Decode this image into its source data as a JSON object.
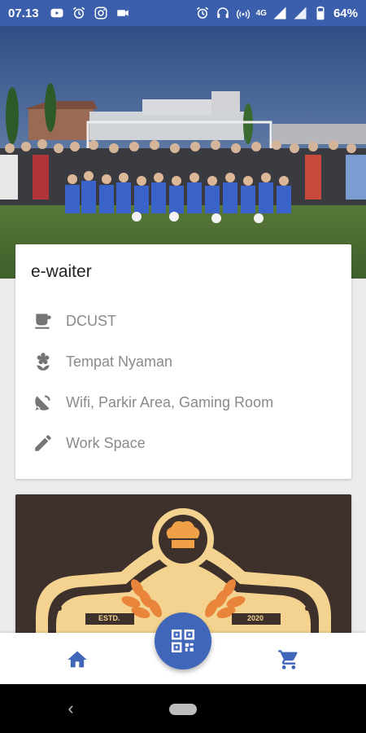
{
  "status_bar": {
    "time": "07.13",
    "left_icons": [
      "youtube-icon",
      "alarm-icon",
      "instagram-icon",
      "video-icon"
    ],
    "right_icons": [
      "alarm-icon",
      "headset-icon",
      "hotspot-icon",
      "signal-4g-icon",
      "signal-icon",
      "battery-icon"
    ],
    "network": "4G",
    "battery": "64%",
    "bg_color": "#3b5fad"
  },
  "carousel": {
    "image_name": "team-photo",
    "dots": [
      {
        "active": true
      },
      {
        "active": false
      }
    ]
  },
  "info_card": {
    "title": "e-waiter",
    "rows": [
      {
        "icon": "coffee-cup-icon",
        "label": "DCUST"
      },
      {
        "icon": "flower-icon",
        "label": "Tempat Nyaman"
      },
      {
        "icon": "satellite-dish-icon",
        "label": "Wifi, Parkir Area, Gaming Room"
      },
      {
        "icon": "pencil-icon",
        "label": "Work Space"
      }
    ]
  },
  "logo_card": {
    "estd_label": "ESTD.",
    "year": "2020",
    "icon": "chef-hat-icon"
  },
  "bottom_nav": {
    "home_icon": "home-icon",
    "scan_icon": "qr-code-icon",
    "cart_icon": "cart-icon",
    "accent": "#3f66b8"
  }
}
